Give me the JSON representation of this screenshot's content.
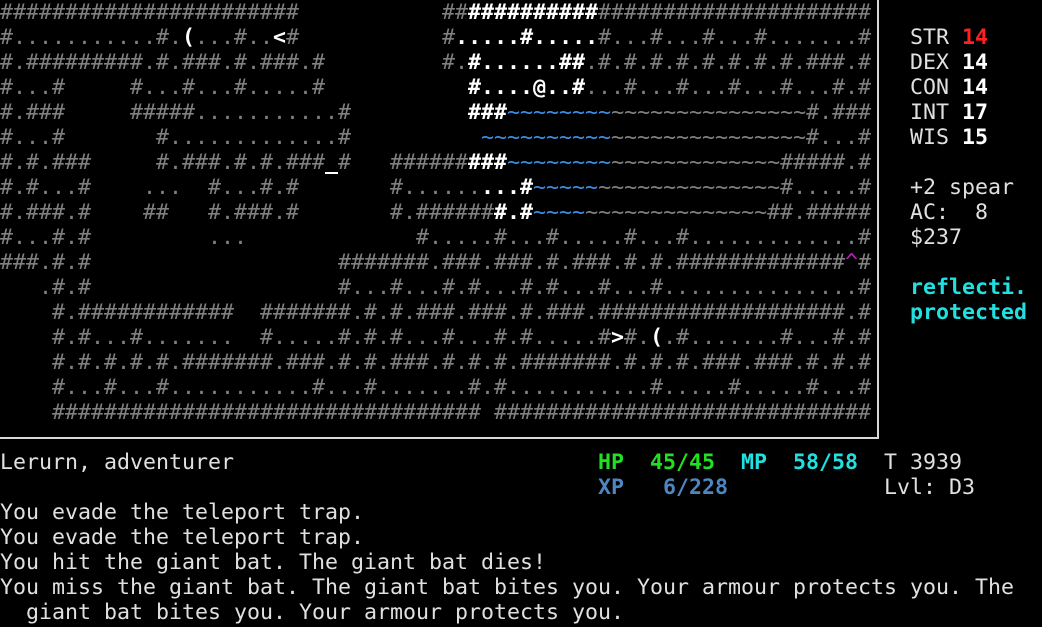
{
  "colors": {
    "-": "#808080",
    "w": "#ffffff",
    "b": "#3a8ee6",
    "m": "#c020c0",
    "stat_low": "#ff2020",
    "hp": "#22e022",
    "mp": "#22e0e0",
    "xp": "#4f86c0",
    "status_effect": "#22e0e0"
  },
  "map": {
    "rows": [
      {
        "text": "#######################           #################################",
        "mask": "------------------------------------wwwwwwwwww"
      },
      {
        "text": "#...........#.(...#..<#           #.....#.....#...#...#...#.......#",
        "mask": "--------------w------w-------------wwwwwwwwwww"
      },
      {
        "text": "#.#########.#.###.#.###.#         #.#......##.#.#.#.#.#.#.#.#.###.#",
        "mask": "------------------------------------wwwwwwwww"
      },
      {
        "text": "#...#     #...#...#.....#           #....@..#...#...#...#...#...#.#",
        "mask": "------------------------------------wwwwwwwww"
      },
      {
        "text": "#.###     #####...........#         ###~~~~~~~~~~~~~~~~~~~~~~~#.###",
        "mask": "------------------------------------wwwbbbbbbbb"
      },
      {
        "text": "#...#       #.............#          ~~~~~~~~~~~~~~~~~~~~~~~~~#...#",
        "mask": "-------------------------------------bbbbbbbbbb"
      },
      {
        "text": "#.#.###     #.###.#.#.###_#   #########~~~~~~~~~~~~~~~~~~~~~#####.#",
        "mask": "-------------------------w----------wwwbbbbbbbb"
      },
      {
        "text": "#.#...#    ...  #...#.#       #.........#~~~~~~~~~~~~~~~~~~~#.....#",
        "mask": "-------------------------------------wwwwbbbbb"
      },
      {
        "text": "#.###.#    ##   #.###.#       #.#######.#~~~~~~~~~~~~~~~~~~##.#####",
        "mask": "--------------------------------------wwwbbbb"
      },
      {
        "text": "#...#.#         ...             #.....#...#.....#...#.............#",
        "mask": ""
      },
      {
        "text": "###.#.#                   #######.###.###.#.###.#.#.#############^#",
        "mask": "-----------------------------------------------------------------m"
      },
      {
        "text": "   .#.#                   #...#...#.#...#.#...#...#...............#",
        "mask": ""
      },
      {
        "text": "    #.############  #######.#.#.###.###.#.###.###################.#",
        "mask": ""
      },
      {
        "text": "    #.#...#.......  #.....#.#.#...#...#.#.....#>#.(.#.......#...#.#",
        "mask": "-----------------------------------------------w--w"
      },
      {
        "text": "    #.#.#.#.#.#######.###.#.#.###.#.#.#.#######.#.#.#.###.###.#.#.#",
        "mask": ""
      },
      {
        "text": "    #...#...#...........#...#.......#.#...........#.....#.....#...#",
        "mask": ""
      },
      {
        "text": "    ################################# #############################",
        "mask": ""
      }
    ]
  },
  "stats": [
    {
      "label": "STR",
      "value": "14",
      "low": true
    },
    {
      "label": "DEX",
      "value": "14"
    },
    {
      "label": "CON",
      "value": "14"
    },
    {
      "label": "INT",
      "value": "17"
    },
    {
      "label": "WIS",
      "value": "15"
    }
  ],
  "equipment": {
    "weapon": "+2 spear",
    "ac": "AC:  8",
    "gold": "$237"
  },
  "effects": [
    "reflecti.",
    "protected"
  ],
  "status": {
    "character": "Lerurn, adventurer",
    "hp_label": "HP",
    "hp_value": "45/45",
    "mp_label": "MP",
    "mp_value": "58/58",
    "xp_label": "XP",
    "xp_value": "6/228",
    "turn": "T 3939",
    "level": "Lvl: D3"
  },
  "messages": [
    "You evade the teleport trap.",
    "You evade the teleport trap.",
    "You hit the giant bat. The giant bat dies!",
    "You miss the giant bat. The giant bat bites you. Your armour protects you. The",
    "  giant bat bites you. Your armour protects you."
  ]
}
